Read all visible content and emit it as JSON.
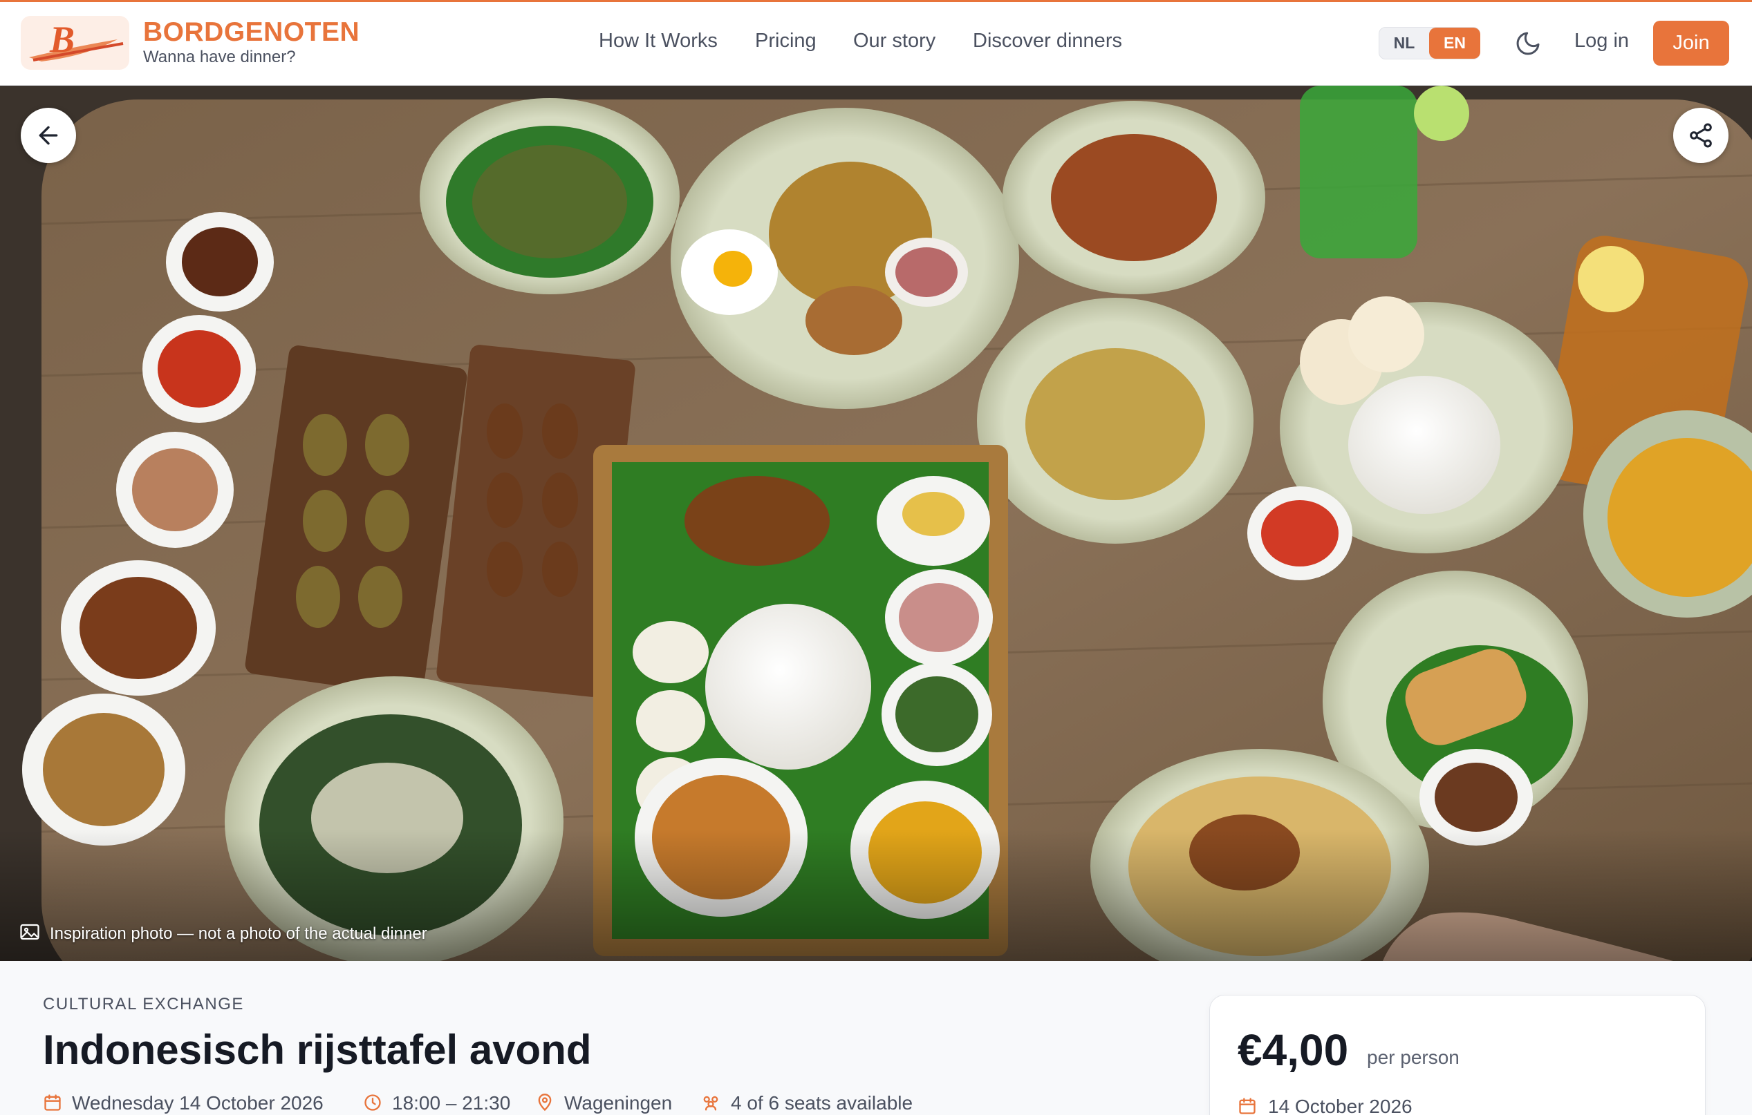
{
  "brand": {
    "name": "BORDGENOTEN",
    "tagline": "Wanna have dinner?",
    "logo_letter": "B"
  },
  "nav": {
    "items": [
      {
        "label": "How It Works"
      },
      {
        "label": "Pricing"
      },
      {
        "label": "Our story"
      },
      {
        "label": "Discover dinners"
      }
    ]
  },
  "language": {
    "options": [
      "NL",
      "EN"
    ],
    "selected": "EN"
  },
  "header_actions": {
    "theme_icon": "moon-icon",
    "login_label": "Log in",
    "join_label": "Join"
  },
  "hero": {
    "caption": "Inspiration photo — not a photo of the actual dinner",
    "back_icon": "arrow-left-icon",
    "share_icon": "share-icon"
  },
  "event": {
    "category": "CULTURAL EXCHANGE",
    "title": "Indonesisch rijsttafel avond",
    "date": "Wednesday 14 October 2026",
    "time": "18:00 – 21:30",
    "location": "Wageningen",
    "seats": "4 of 6 seats available"
  },
  "booking": {
    "price": "€4,00",
    "per_person": "per person",
    "date": "14 October 2026"
  },
  "colors": {
    "accent": "#e8743b",
    "text": "#161a24",
    "muted": "#4b5160"
  }
}
